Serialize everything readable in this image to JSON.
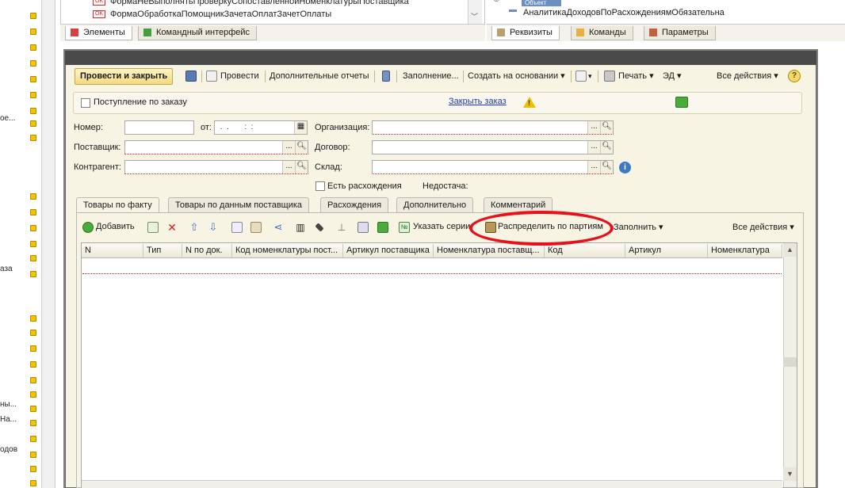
{
  "left_fragments": [
    "ое...",
    "аза",
    "ны...",
    "На...",
    "одов"
  ],
  "top_tree": {
    "rows": [
      "ФормаНеВыполнятьПроверкуСопоставленнойНоменклатурыПоставщика",
      "ФормаОбработкаПомощникЗачетаОплатЗачетОплаты"
    ],
    "badge": "OK"
  },
  "top_right": {
    "object_chip": "Объект",
    "row": "АналитикаДоходовПоРасхождениямОбязательна"
  },
  "bottom_tabs_left": [
    {
      "label": "Элементы",
      "active": true
    },
    {
      "label": "Командный интерфейс",
      "active": false
    }
  ],
  "bottom_tabs_right": [
    {
      "label": "Реквизиты",
      "active": true
    },
    {
      "label": "Команды",
      "active": false
    },
    {
      "label": "Параметры",
      "active": false
    }
  ],
  "toolbar": {
    "post_close": "Провести и закрыть",
    "post": "Провести",
    "extra_reports": "Дополнительные отчеты",
    "fill": "Заполнение...",
    "create_based": "Создать на основании ▾",
    "print": "Печать ▾",
    "ed": "ЭД ▾",
    "all_actions": "Все действия ▾",
    "help": "?"
  },
  "order_bar": {
    "checkbox_label": "Поступление по заказу",
    "close_order_link": "Закрыть заказ"
  },
  "fields": {
    "number_label": "Номер:",
    "from_label": "от:",
    "date_placeholder": " .  .       :  :",
    "org_label": "Организация:",
    "supplier_label": "Поставщик:",
    "contract_label": "Договор:",
    "counterparty_label": "Контрагент:",
    "warehouse_label": "Склад:",
    "has_discrepancy": "Есть расхождения",
    "shortage": "Недостача:"
  },
  "tabs": [
    {
      "label": "Товары по факту",
      "active": true
    },
    {
      "label": "Товары по данным поставщика",
      "active": false
    },
    {
      "label": "Расхождения",
      "active": false
    },
    {
      "label": "Дополнительно",
      "active": false
    },
    {
      "label": "Комментарий",
      "active": false
    }
  ],
  "table_toolbar": {
    "add": "Добавить",
    "specify_series": "Указать серии",
    "distribute": "Распределить по партиям",
    "fill": "Заполнить ▾",
    "all_actions": "Все действия ▾"
  },
  "grid_columns": [
    "N",
    "Тип",
    "N по док.",
    "Код номенклатуры пост...",
    "Артикул поставщика",
    "Номенклатура поставщ...",
    "Код",
    "Артикул",
    "Номенклатура"
  ],
  "colors": {
    "form_background": "#f7f4e4",
    "annotation_red": "#e8101a",
    "link_blue": "#1a3ca8"
  }
}
